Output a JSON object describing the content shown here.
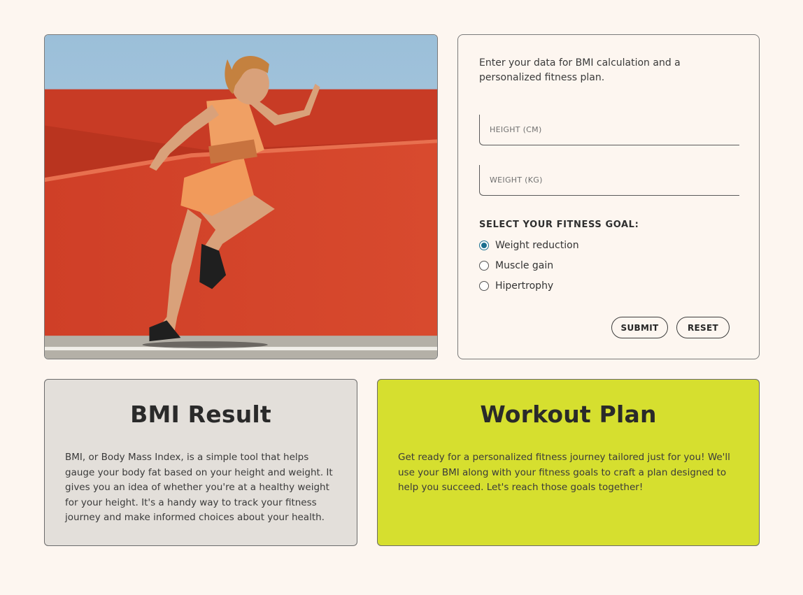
{
  "hero": {
    "image_icon": "runner-photo-icon"
  },
  "form": {
    "intro": "Enter your data for BMI calculation and a personalized fitness plan.",
    "height_placeholder": "HEIGHT (CM)",
    "height_value": "",
    "weight_placeholder": "WEIGHT (KG)",
    "weight_value": "",
    "goal_label": "SELECT YOUR FITNESS GOAL:",
    "goals": [
      {
        "label": "Weight reduction",
        "checked": true
      },
      {
        "label": "Muscle gain",
        "checked": false
      },
      {
        "label": "Hipertrophy",
        "checked": false
      }
    ],
    "submit_label": "SUBMIT",
    "reset_label": "RESET"
  },
  "bmi_card": {
    "title": "BMI Result",
    "body": "BMI, or Body Mass Index, is a simple tool that helps gauge your body fat based on your height and weight. It gives you an idea of whether you're at a healthy weight for your height. It's a handy way to track your fitness journey and make informed choices about your health."
  },
  "plan_card": {
    "title": "Workout Plan",
    "body": "Get ready for a personalized fitness journey tailored just for you! We'll use your BMI along with your fitness goals to craft a plan designed to help you succeed. Let's reach those goals together!"
  },
  "colors": {
    "page_bg": "#fdf6f0",
    "radio_accent": "#1a6f8f",
    "bmi_card_bg": "#e3dfda",
    "plan_card_bg": "#d6df2f",
    "wall_red": "#d8442c"
  }
}
